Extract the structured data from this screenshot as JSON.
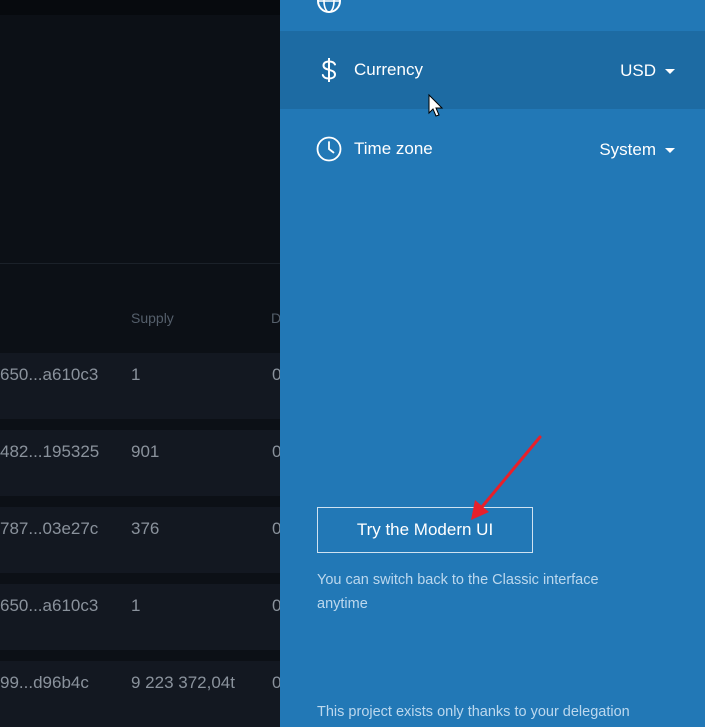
{
  "background": {
    "table": {
      "header_supply": "Supply",
      "header_next_partial": "D",
      "rows": [
        {
          "hash": "650...a610c3",
          "supply": "1",
          "next": "0"
        },
        {
          "hash": "482...195325",
          "supply": "901",
          "next": "0"
        },
        {
          "hash": "787...03e27c",
          "supply": "376",
          "next": "0"
        },
        {
          "hash": "650...a610c3",
          "supply": "1",
          "next": "0"
        },
        {
          "hash": "99...d96b4c",
          "supply": "9 223 372,04t",
          "next": "0"
        }
      ]
    }
  },
  "settings": {
    "items": [
      {
        "label": "Currency",
        "value": "USD",
        "icon": "dollar-icon"
      },
      {
        "label": "Time zone",
        "value": "System",
        "icon": "clock-icon"
      }
    ],
    "top_icon": "globe-icon",
    "modern_ui_button": "Try the Modern UI",
    "switch_hint": "You can switch back to the Classic interface anytime",
    "footer": "This project exists only thanks to your delegation"
  },
  "colors": {
    "panel": "#2278b6",
    "panel_active_row": "#1d6ba3",
    "background": "#0c1117",
    "annotation_arrow": "#e8202a"
  }
}
